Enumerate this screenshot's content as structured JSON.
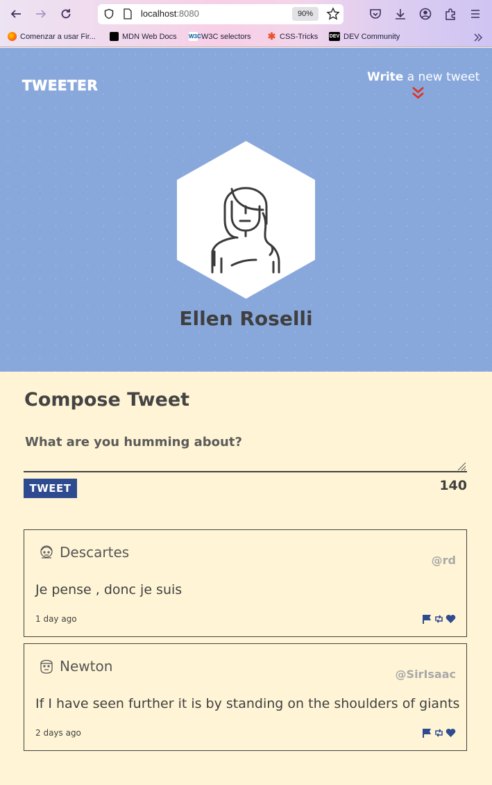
{
  "browser": {
    "url_host": "localhost",
    "url_port": ":8080",
    "zoom": "90%",
    "bookmarks": [
      {
        "label": "Comenzar a usar Fir...",
        "icon": "firefox-icon"
      },
      {
        "label": "MDN Web Docs",
        "icon": "mdn-icon"
      },
      {
        "label": "W3C selectors",
        "icon": "w3c-icon"
      },
      {
        "label": "CSS-Tricks",
        "icon": "css-tricks-icon"
      },
      {
        "label": "DEV Community",
        "icon": "dev-icon"
      }
    ]
  },
  "header": {
    "brand": "Tweeter",
    "write_bold": "Write",
    "write_rest": " a new tweet"
  },
  "profile": {
    "name": "Ellen Roselli"
  },
  "compose": {
    "title": "Compose Tweet",
    "placeholder": "What are you humming about?",
    "button_label": "Tweet",
    "counter": "140"
  },
  "tweets": [
    {
      "name": "Descartes",
      "handle": "@rd",
      "text": "Je pense , donc je suis",
      "time": "1 day ago"
    },
    {
      "name": "Newton",
      "handle": "@SirIsaac",
      "text": "If I have seen further it is by standing on the shoulders of giants",
      "time": "2 days ago"
    }
  ],
  "colors": {
    "hero_bg": "#88a8dc",
    "page_bg": "#fff5d6",
    "accent_red": "#e0301e",
    "button_blue": "#2f4b8f",
    "text_dark": "#3f3f3f"
  }
}
